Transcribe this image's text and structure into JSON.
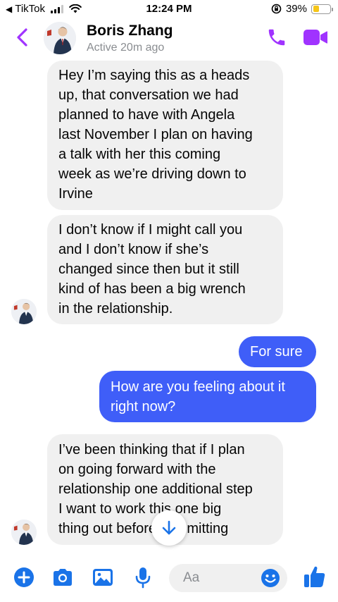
{
  "status_bar": {
    "back_app": "TikTok",
    "time": "12:24 PM",
    "battery_pct": "39%",
    "battery_level": 0.39
  },
  "header": {
    "name": "Boris Zhang",
    "status": "Active 20m ago",
    "accent_color": "#a033ff"
  },
  "messages": [
    {
      "from": "them",
      "lines": [
        "Hey I’m saying this as a heads",
        "up, that conversation we had",
        "planned to have with Angela",
        "last November I plan on having",
        "a talk with her this coming",
        "week as we’re driving down to",
        "Irvine"
      ]
    },
    {
      "from": "them",
      "lines": [
        "I don’t know if I might call you",
        "and I don’t know if she’s",
        "changed since then but it still",
        "kind of has been a big wrench",
        "in the relationship."
      ]
    },
    {
      "from": "me",
      "lines": [
        "For sure"
      ]
    },
    {
      "from": "me",
      "lines": [
        "How are you feeling about it",
        "right now?"
      ]
    },
    {
      "from": "them",
      "lines": [
        "I’ve been thinking that if I plan",
        "on going forward with the",
        "relationship one additional step",
        "I want to work this one big",
        "thing out before committing"
      ]
    }
  ],
  "composer": {
    "placeholder": "Aa",
    "icon_color": "#1a73e8"
  }
}
